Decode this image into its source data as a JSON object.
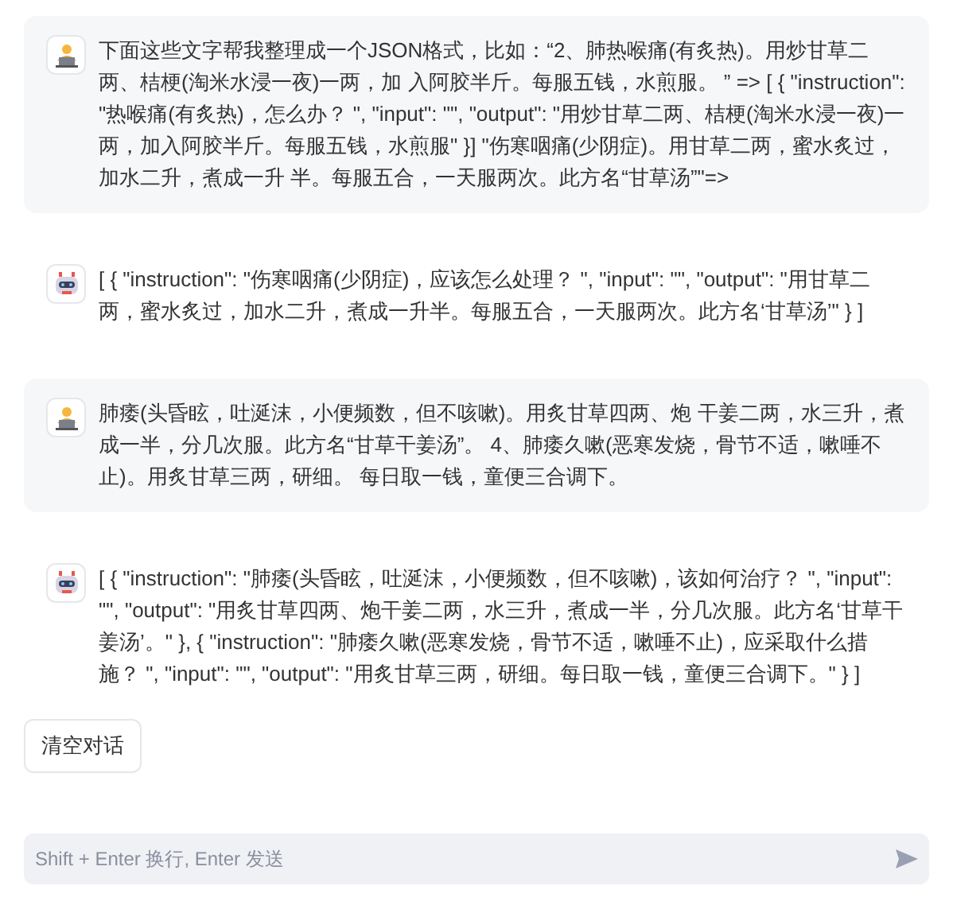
{
  "messages": [
    {
      "kind": "user",
      "text": "下面这些文字帮我整理成一个JSON格式，比如：“2、肺热喉痛(有炙热)。用炒甘草二两、桔梗(淘米水浸一夜)一两，加 入阿胶半斤。每服五钱，水煎服。 ” => [ { \"instruction\": \"热喉痛(有炙热)，怎么办？ \", \"input\": \"\", \"output\": \"用炒甘草二两、桔梗(淘米水浸一夜)一两，加入阿胶半斤。每服五钱，水煎服\" }] \"伤寒咽痛(少阴症)。用甘草二两，蜜水炙过，加水二升，煮成一升 半。每服五合，一天服两次。此方名“甘草汤”\"=>"
    },
    {
      "kind": "bot",
      "text": "[ { \"instruction\": \"伤寒咽痛(少阴症)，应该怎么处理？ \", \"input\": \"\", \"output\": \"用甘草二两，蜜水炙过，加水二升，煮成一升半。每服五合，一天服两次。此方名‘甘草汤’\" } ]"
    },
    {
      "kind": "user",
      "text": "肺痿(头昏眩，吐涎沫，小便频数，但不咳嗽)。用炙甘草四两、炮 干姜二两，水三升，煮成一半，分几次服。此方名“甘草干姜汤”。 4、肺痿久嗽(恶寒发烧，骨节不适，嗽唾不止)。用炙甘草三两，研细。 每日取一钱，童便三合调下。"
    },
    {
      "kind": "bot",
      "text": "[ { \"instruction\": \"肺痿(头昏眩，吐涎沫，小便频数，但不咳嗽)，该如何治疗？ \", \"input\": \"\", \"output\": \"用炙甘草四两、炮干姜二两，水三升，煮成一半，分几次服。此方名‘甘草干姜汤’。\" }, { \"instruction\": \"肺痿久嗽(恶寒发烧，骨节不适，嗽唾不止)，应采取什么措施？ \", \"input\": \"\", \"output\": \"用炙甘草三两，研细。每日取一钱，童便三合调下。\" } ]"
    }
  ],
  "clear_button": "清空对话",
  "input": {
    "placeholder": "Shift + Enter 换行, Enter 发送"
  }
}
